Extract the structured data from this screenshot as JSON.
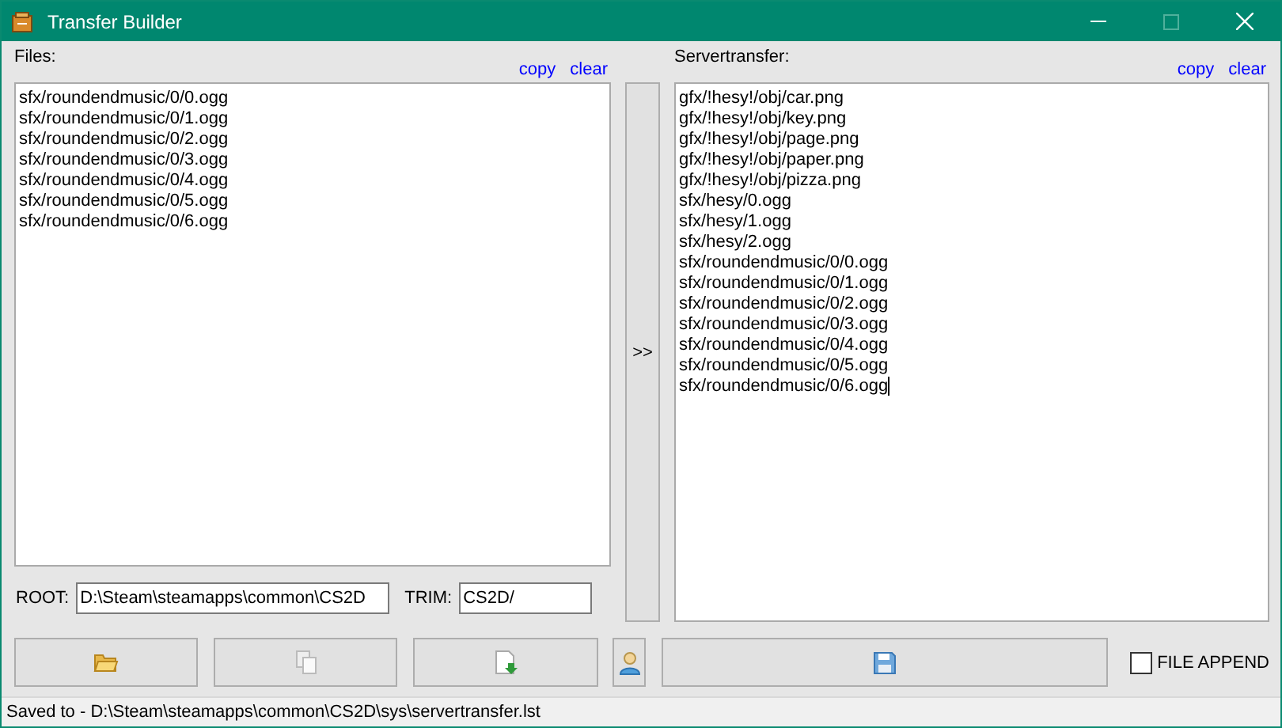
{
  "window": {
    "title": "Transfer Builder"
  },
  "files": {
    "label": "Files:",
    "links": [
      "copy",
      "clear"
    ],
    "items": [
      "sfx/roundendmusic/0/0.ogg",
      "sfx/roundendmusic/0/1.ogg",
      "sfx/roundendmusic/0/2.ogg",
      "sfx/roundendmusic/0/3.ogg",
      "sfx/roundendmusic/0/4.ogg",
      "sfx/roundendmusic/0/5.ogg",
      "sfx/roundendmusic/0/6.ogg"
    ]
  },
  "transfer_button": {
    "label": ">>"
  },
  "servertransfer": {
    "label": "Servertransfer:",
    "links": [
      "copy",
      "clear"
    ],
    "items": [
      "gfx/!hesy!/obj/car.png",
      "gfx/!hesy!/obj/key.png",
      "gfx/!hesy!/obj/page.png",
      "gfx/!hesy!/obj/paper.png",
      "gfx/!hesy!/obj/pizza.png",
      "sfx/hesy/0.ogg",
      "sfx/hesy/1.ogg",
      "sfx/hesy/2.ogg",
      "sfx/roundendmusic/0/0.ogg",
      "sfx/roundendmusic/0/1.ogg",
      "sfx/roundendmusic/0/2.ogg",
      "sfx/roundendmusic/0/3.ogg",
      "sfx/roundendmusic/0/4.ogg",
      "sfx/roundendmusic/0/5.ogg",
      "sfx/roundendmusic/0/6.ogg"
    ]
  },
  "root": {
    "label": "ROOT:",
    "value": "D:\\Steam\\steamapps\\common\\CS2D"
  },
  "trim": {
    "label": "TRIM:",
    "value": "CS2D/"
  },
  "file_append": {
    "label": "FILE APPEND",
    "checked": false
  },
  "status_bar": "Saved to - D:\\Steam\\steamapps\\common\\CS2D\\sys\\servertransfer.lst"
}
